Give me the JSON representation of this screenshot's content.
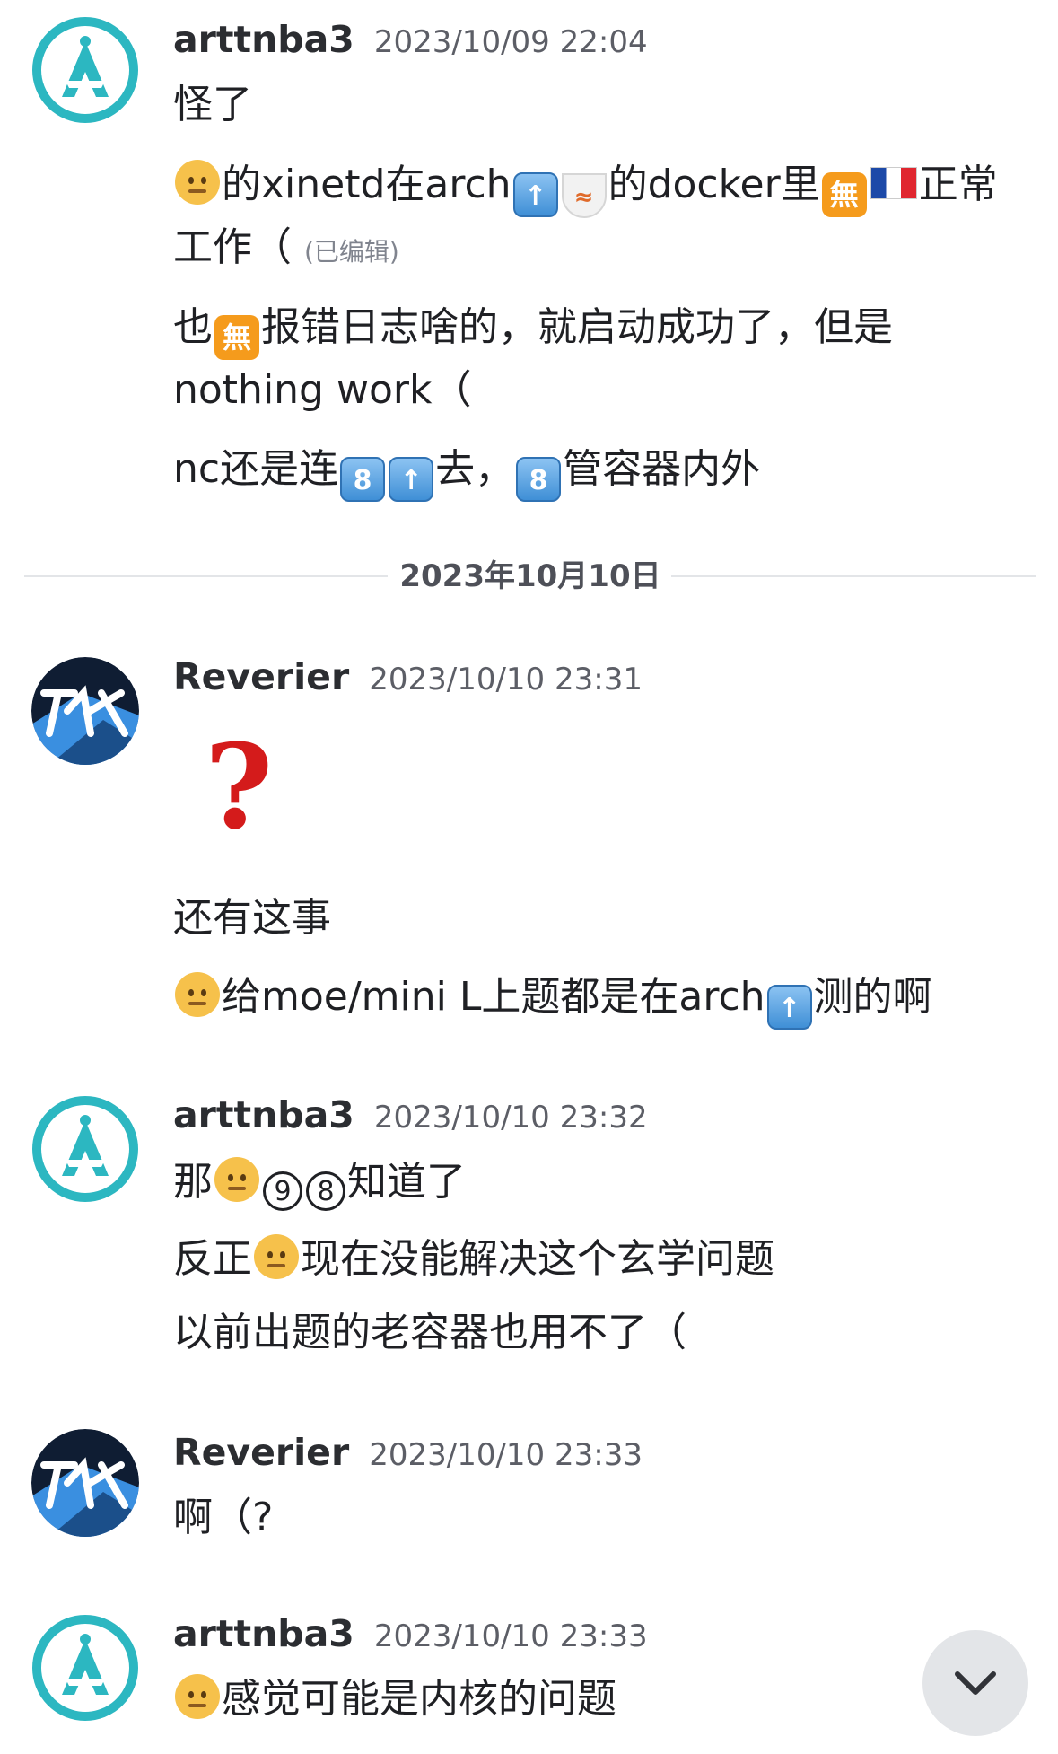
{
  "messages": [
    {
      "author": "arttnba3",
      "time": "2023/10/09 22:04",
      "lines": {
        "l1": "怪了",
        "l2a": "的xinetd在arch",
        "l2b": "的docker里",
        "l2c": "正常",
        "l3": "工作（",
        "l3_edited": "(已编辑)",
        "l4a": "也",
        "l4b": "报错日志啥的，就启动成功了，但是",
        "l5": "nothing work（",
        "l6a": "nc还是连",
        "l6b": "去，",
        "l6c": "管容器内外"
      }
    },
    {
      "author": "Reverier",
      "time": "2023/10/10 23:31",
      "lines": {
        "big_emoji": "?",
        "l1": "还有这事",
        "l2a": "给moe/mini L上题都是在arch",
        "l2b": "测的啊"
      }
    },
    {
      "author": "arttnba3",
      "time": "2023/10/10 23:32",
      "lines": {
        "l1a": "那",
        "l1b": "知道了",
        "l2a": "反正",
        "l2b": "现在没能解决这个玄学问题",
        "l3": "以前出题的老容器也用不了（"
      }
    },
    {
      "author": "Reverier",
      "time": "2023/10/10 23:33",
      "lines": {
        "l1": "啊（?"
      }
    },
    {
      "author": "arttnba3",
      "time": "2023/10/10 23:33",
      "lines": {
        "l1": "感觉可能是内核的问题"
      }
    }
  ],
  "date_divider": "2023年10月10日",
  "glyphs": {
    "keycap_8": "8",
    "wu": "無",
    "bowl": "🍜",
    "circled_9": "9",
    "circled_8": "8"
  },
  "icons": {
    "face": "slightly-frowning-face-icon",
    "up_arrow": "up-arrow-keycap-icon",
    "scroll_down": "chevron-down-icon"
  },
  "colors": {
    "avatar_teal": "#2cb7c1",
    "avatar_dark": "#0f1d33",
    "avatar_blue": "#3a8fe0",
    "question_red": "#d41b1b"
  }
}
